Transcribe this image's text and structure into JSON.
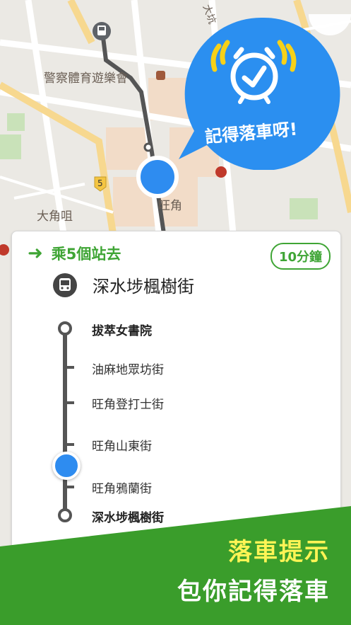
{
  "map": {
    "labels": {
      "police_club": "警察體育遊樂會",
      "mong_kok": "旺角",
      "tai_kok_tsui": "大角咀",
      "tai_hang": "大坑",
      "route_number": "5"
    }
  },
  "reminder_bubble": {
    "text": "記得落車呀!",
    "icon": "alarm-clock-icon"
  },
  "trip_card": {
    "ride_label": "乘5個站去",
    "eta_label": "10分鐘",
    "destination": "深水埗楓樹街",
    "stops": [
      {
        "name": "拔萃女書院"
      },
      {
        "name": "油麻地眾坊街"
      },
      {
        "name": "旺角登打士街"
      },
      {
        "name": "旺角山東街"
      },
      {
        "name": "旺角鴉蘭街"
      },
      {
        "name": "深水埗楓樹街"
      }
    ]
  },
  "promo": {
    "line1": "落車提示",
    "line2": "包你記得落車"
  },
  "colors": {
    "accent_green": "#3fa535",
    "banner_green": "#3a9d2b",
    "bubble_blue": "#2b8ff0",
    "alarm_yellow": "#f7d118",
    "location_blue": "#2e8cf0"
  }
}
